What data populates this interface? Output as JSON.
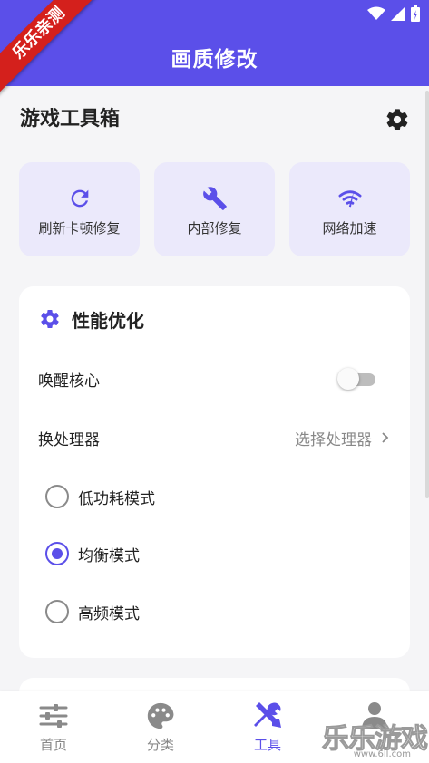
{
  "status_bar": {
    "icons": [
      "wifi-icon",
      "signal-icon",
      "battery-charging-icon"
    ]
  },
  "ribbon": {
    "text": "乐乐亲测"
  },
  "appbar": {
    "title": "画质修改"
  },
  "toolbox": {
    "title": "游戏工具箱",
    "settings_icon": "gear-icon"
  },
  "tools": [
    {
      "label": "刷新卡顿修复",
      "icon": "refresh-icon"
    },
    {
      "label": "内部修复",
      "icon": "wrench-icon"
    },
    {
      "label": "网络加速",
      "icon": "network-speed-icon"
    }
  ],
  "perf": {
    "title": "性能优化",
    "wake_core_label": "唤醒核心",
    "wake_core_on": false,
    "cpu_label": "换处理器",
    "cpu_select": "选择处理器",
    "modes": [
      {
        "label": "低功耗模式",
        "selected": false
      },
      {
        "label": "均衡模式",
        "selected": true
      },
      {
        "label": "高频模式",
        "selected": false
      }
    ]
  },
  "nav": [
    {
      "label": "首页",
      "icon": "sliders-icon",
      "active": false
    },
    {
      "label": "分类",
      "icon": "palette-icon",
      "active": false
    },
    {
      "label": "工具",
      "icon": "tools-icon",
      "active": true
    },
    {
      "label": "",
      "icon": "person-icon",
      "active": false
    }
  ],
  "watermark": {
    "text": "乐乐游戏",
    "url": "www.6ll.com"
  },
  "colors": {
    "accent": "#5b4fe9",
    "accent_soft": "#ebe9fb",
    "ribbon": "#d4201c"
  }
}
